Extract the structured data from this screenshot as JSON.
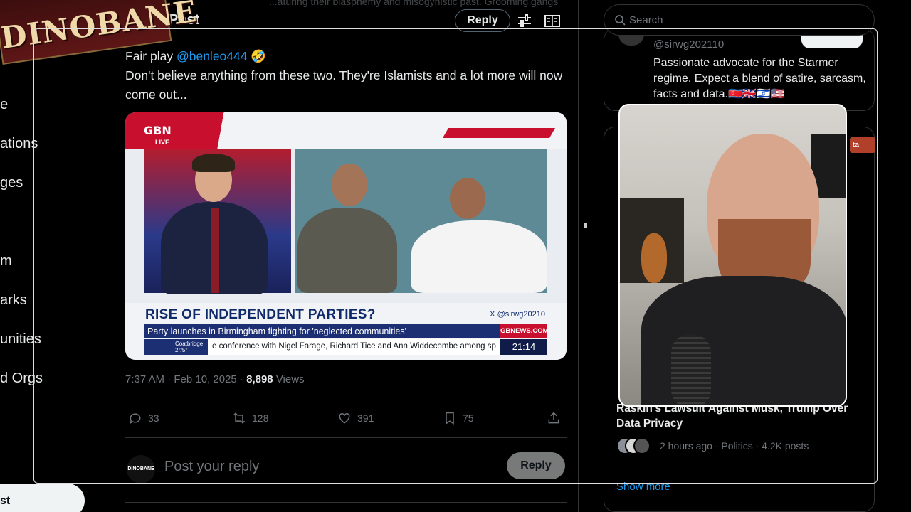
{
  "sidebar": {
    "items": [
      {
        "label": "e"
      },
      {
        "label": "ations"
      },
      {
        "label": "ges"
      },
      {
        "label": "m"
      },
      {
        "label": "arks"
      },
      {
        "label": "unities"
      },
      {
        "label": "d Orgs"
      }
    ],
    "post_button": "st",
    "logo_text": "DINOBANE"
  },
  "header": {
    "title": "Post",
    "reply_label": "Reply",
    "faded_text": "...aturing their blasphemy and misogynistic past. Grooming gangs"
  },
  "tweet": {
    "line1_prefix": "Fair play ",
    "mention": "@benleo444",
    "emoji": "🤣",
    "body": "Don't believe anything from these two. They're Islamists and a lot more will now come out...",
    "timestamp": "7:37 AM · Feb 10, 2025 · ",
    "views_count": "8,898",
    "views_label": " Views"
  },
  "media": {
    "logo": "GBN",
    "live": "LIVE",
    "headline": "RISE OF INDEPENDENT PARTIES?",
    "handle": "X @sirwg20210",
    "subheadline": "Party launches in Birmingham fighting for 'neglected communities'",
    "channel_tag": "GBNEWS.COM",
    "weather_location": "Coatbridge",
    "weather_temp": "2°/5°",
    "ticker": "e conference with Nigel Farage, Richard Tice and Ann Widdecombe among sp",
    "clock": "21:14"
  },
  "actions": {
    "replies": "33",
    "reposts": "128",
    "likes": "391",
    "bookmarks": "75"
  },
  "composer": {
    "avatar_text": "DINOBANE",
    "placeholder": "Post your reply",
    "reply_button": "Reply"
  },
  "right": {
    "search_placeholder": "Search",
    "profile_handle": "@sirwg202110",
    "profile_bio": "Passionate advocate for the Starmer regime. Expect a blend of satire, sarcasm, facts and data.🇰🇵🇬🇧🇮🇱🇺🇸",
    "live_badge": "ta",
    "trend_title": "Raskin's Lawsuit Against Musk, Trump Over Data Privacy",
    "trend_meta": "2 hours ago · Politics · 4.2K posts",
    "show_more": "Show more"
  },
  "colors": {
    "accent": "#1d9bf0",
    "background": "#000000",
    "muted": "#71767b",
    "gbn_red": "#c8102e",
    "gbn_blue": "#1d2f73"
  }
}
